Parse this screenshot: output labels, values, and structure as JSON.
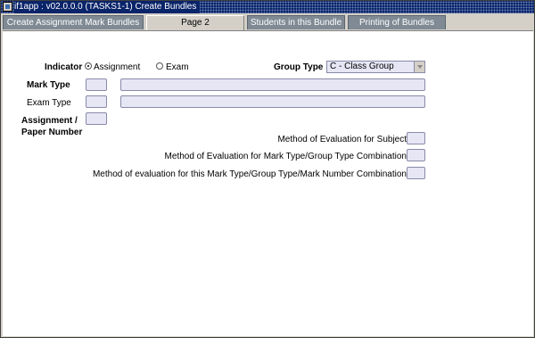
{
  "window": {
    "title": "if1app : v02.0.0.0 (TASKS1-1) Create Bundles"
  },
  "tabs": [
    {
      "label": "Create Assignment Mark Bundles",
      "active": false
    },
    {
      "label": "Page 2",
      "active": true
    },
    {
      "label": "Students in this Bundle",
      "active": false
    },
    {
      "label": "Printing of Bundles",
      "active": false
    }
  ],
  "form": {
    "indicator_label": "Indicator",
    "indicator_options": [
      {
        "label": "Assignment",
        "checked": true
      },
      {
        "label": "Exam",
        "checked": false
      }
    ],
    "group_type_label": "Group Type",
    "group_type_value": "C - Class Group",
    "mark_type_label": "Mark Type",
    "mark_type_value": "",
    "mark_type_desc": "",
    "exam_type_label": "Exam Type",
    "exam_type_value": "",
    "exam_type_desc": "",
    "assignment_label_line1": "Assignment /",
    "assignment_label_line2": "Paper Number",
    "assignment_value": "",
    "method_subject_label": "Method of Evaluation for Subject",
    "method_combo_label": "Method of Evaluation for Mark Type/Group Type Combination",
    "method_full_label": "Method of evaluation for this Mark Type/Group Type/Mark Number Combination"
  }
}
